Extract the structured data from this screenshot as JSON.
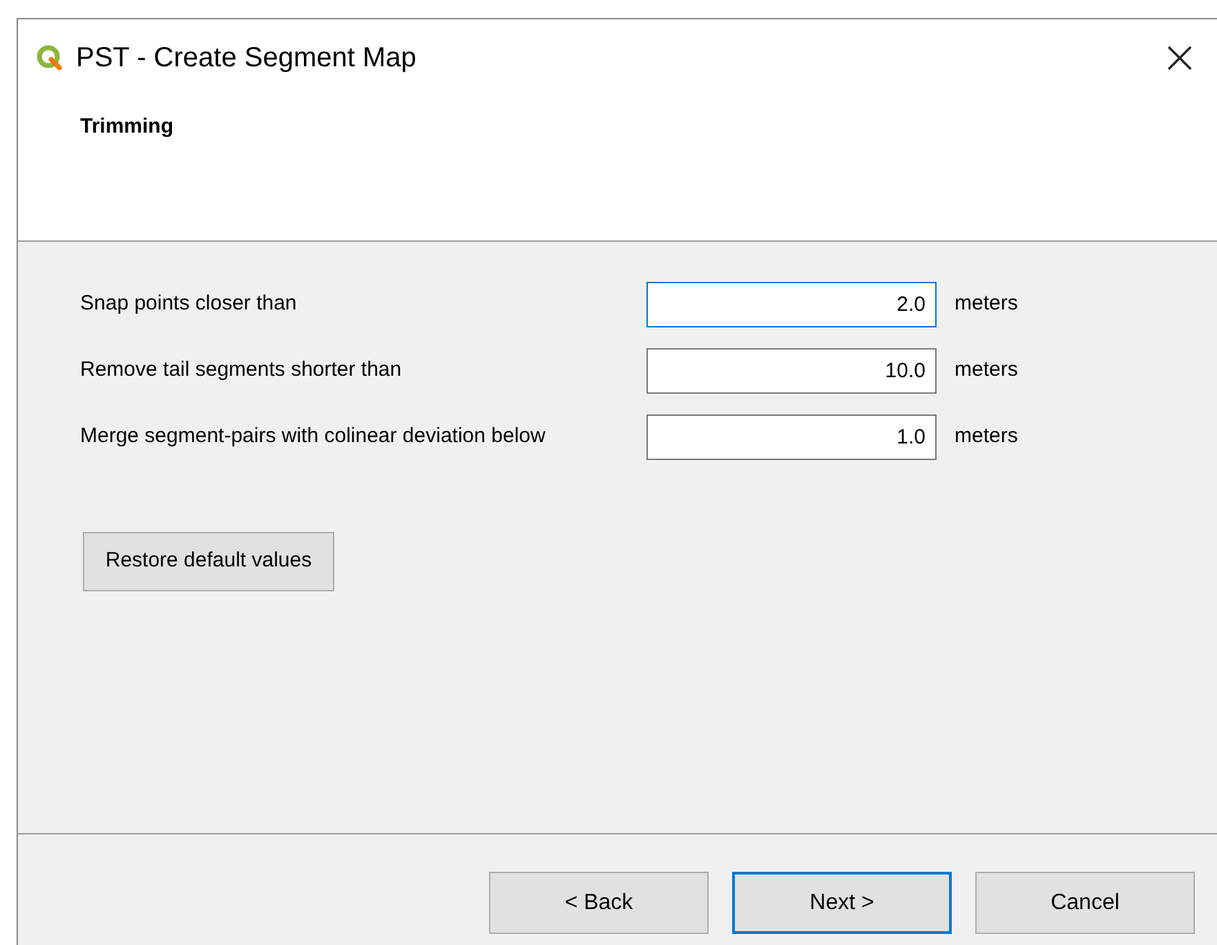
{
  "window": {
    "title": "PST - Create Segment Map"
  },
  "page": {
    "title": "Trimming"
  },
  "fields": [
    {
      "label": "Snap points closer than",
      "value": "2.0",
      "unit": "meters",
      "focused": true
    },
    {
      "label": "Remove tail segments shorter than",
      "value": "10.0",
      "unit": "meters",
      "focused": false
    },
    {
      "label": "Merge segment-pairs with colinear deviation below",
      "value": "1.0",
      "unit": "meters",
      "focused": false
    }
  ],
  "restore_button": "Restore default values",
  "buttons": [
    {
      "label": "< Back",
      "default": false
    },
    {
      "label": "Next >",
      "default": true
    },
    {
      "label": "Cancel",
      "default": false
    }
  ]
}
